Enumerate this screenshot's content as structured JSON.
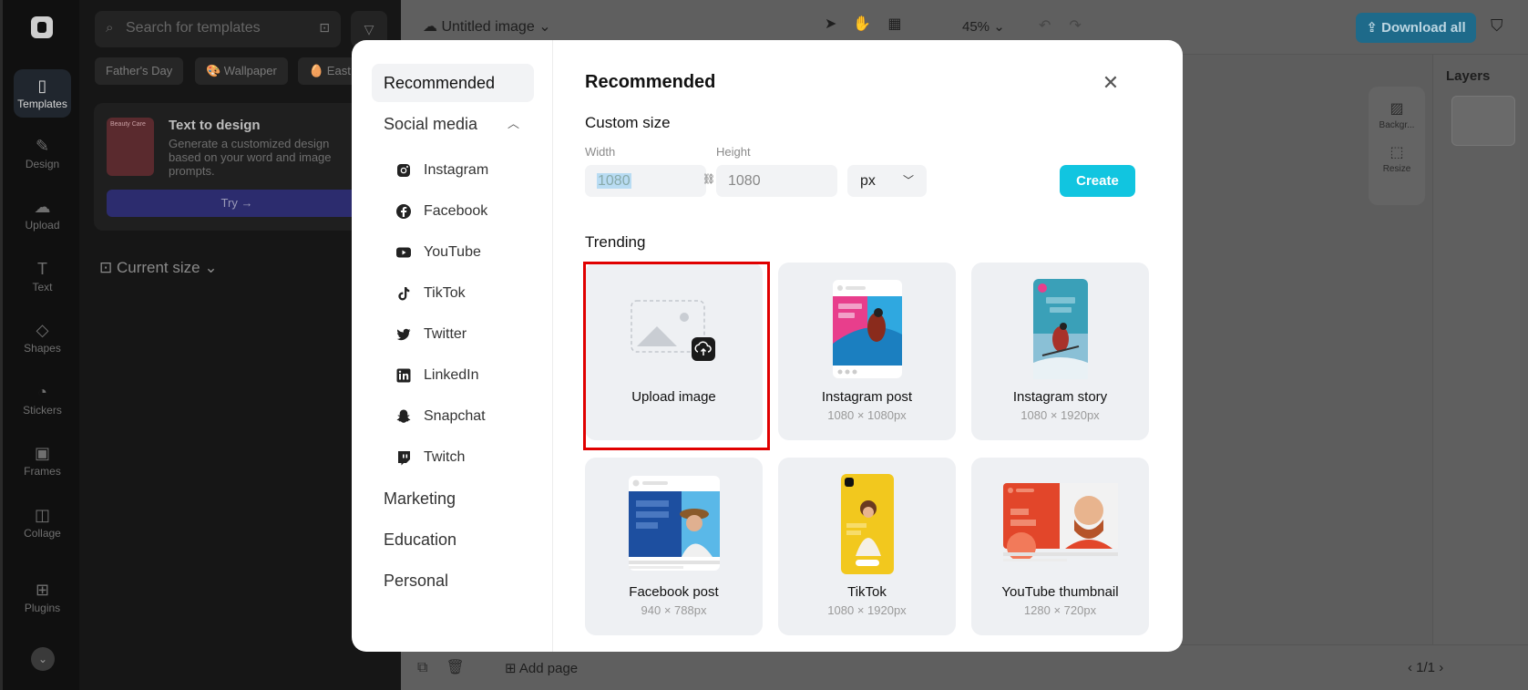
{
  "app": {
    "rail": [
      {
        "label": "Templates",
        "icon": "templates-icon"
      },
      {
        "label": "Design",
        "icon": "design-icon"
      },
      {
        "label": "Upload",
        "icon": "upload-icon"
      },
      {
        "label": "Text",
        "icon": "text-icon"
      },
      {
        "label": "Shapes",
        "icon": "shapes-icon"
      },
      {
        "label": "Stickers",
        "icon": "stickers-icon"
      },
      {
        "label": "Frames",
        "icon": "frames-icon"
      },
      {
        "label": "Collage",
        "icon": "collage-icon"
      },
      {
        "label": "Plugins",
        "icon": "plugins-icon"
      }
    ],
    "search_placeholder": "Search for templates",
    "chips": [
      "Father's Day",
      "🎨 Wallpaper",
      "🥚 East"
    ],
    "text_to_design": {
      "title": "Text to design",
      "description": "Generate a customized design based on your word and image prompts.",
      "button": "Try →",
      "thumb_text": "Beauty Care"
    },
    "current_size": "Current size ⌄",
    "doc_title": "Untitled image",
    "zoom": "45%",
    "download": "Download all",
    "layers": "Layers",
    "float_tools": [
      "Backgr...",
      "Resize"
    ],
    "add_page": "Add page",
    "page_count": "1/1"
  },
  "modal": {
    "sidebar": {
      "recommended": "Recommended",
      "social_media": "Social media",
      "social_items": [
        "Instagram",
        "Facebook",
        "YouTube",
        "TikTok",
        "Twitter",
        "LinkedIn",
        "Snapchat",
        "Twitch"
      ],
      "marketing": "Marketing",
      "education": "Education",
      "personal": "Personal"
    },
    "title": "Recommended",
    "custom_size": "Custom size",
    "width_label": "Width",
    "height_label": "Height",
    "width_value": "1080",
    "height_value": "1080",
    "unit": "px",
    "create": "Create",
    "trending": "Trending",
    "cards": [
      {
        "name": "Upload image",
        "size": ""
      },
      {
        "name": "Instagram post",
        "size": "1080 × 1080px"
      },
      {
        "name": "Instagram story",
        "size": "1080 × 1920px"
      },
      {
        "name": "Facebook post",
        "size": "940 × 788px"
      },
      {
        "name": "TikTok",
        "size": "1080 × 1920px"
      },
      {
        "name": "YouTube thumbnail",
        "size": "1280 × 720px"
      }
    ]
  },
  "colors": {
    "accent": "#11c5e0",
    "highlight": "#e00000"
  }
}
